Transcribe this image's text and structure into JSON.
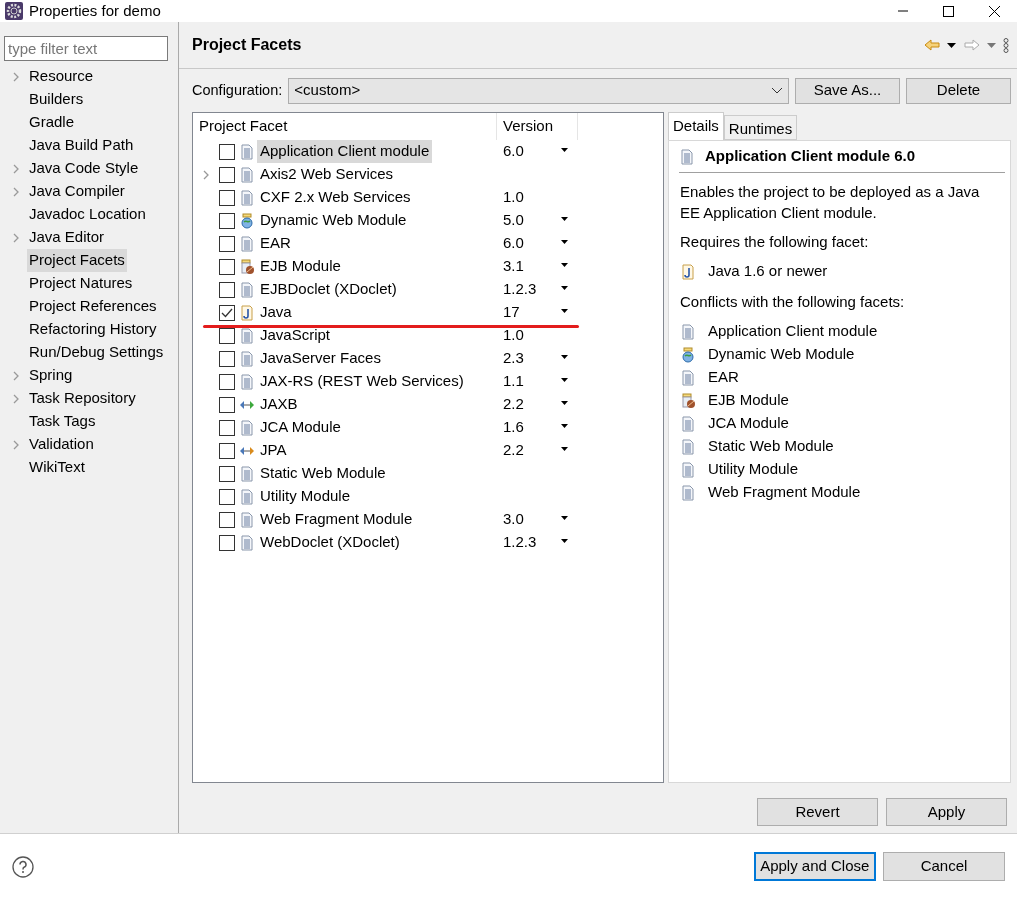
{
  "window": {
    "title": "Properties for demo"
  },
  "filter": {
    "placeholder": "type filter text"
  },
  "sidebar": {
    "items": [
      {
        "label": "Resource",
        "expandable": true,
        "selected": false
      },
      {
        "label": "Builders",
        "expandable": false,
        "selected": false
      },
      {
        "label": "Gradle",
        "expandable": false,
        "selected": false
      },
      {
        "label": "Java Build Path",
        "expandable": false,
        "selected": false
      },
      {
        "label": "Java Code Style",
        "expandable": true,
        "selected": false
      },
      {
        "label": "Java Compiler",
        "expandable": true,
        "selected": false
      },
      {
        "label": "Javadoc Location",
        "expandable": false,
        "selected": false
      },
      {
        "label": "Java Editor",
        "expandable": true,
        "selected": false
      },
      {
        "label": "Project Facets",
        "expandable": false,
        "selected": true
      },
      {
        "label": "Project Natures",
        "expandable": false,
        "selected": false
      },
      {
        "label": "Project References",
        "expandable": false,
        "selected": false
      },
      {
        "label": "Refactoring History",
        "expandable": false,
        "selected": false
      },
      {
        "label": "Run/Debug Settings",
        "expandable": false,
        "selected": false
      },
      {
        "label": "Spring",
        "expandable": true,
        "selected": false
      },
      {
        "label": "Task Repository",
        "expandable": true,
        "selected": false
      },
      {
        "label": "Task Tags",
        "expandable": false,
        "selected": false
      },
      {
        "label": "Validation",
        "expandable": true,
        "selected": false
      },
      {
        "label": "WikiText",
        "expandable": false,
        "selected": false
      }
    ]
  },
  "page": {
    "title": "Project Facets"
  },
  "configuration": {
    "label": "Configuration:",
    "value": "<custom>",
    "buttons": [
      "Save As...",
      "Delete"
    ]
  },
  "facets": {
    "columns": [
      "Project Facet",
      "Version"
    ],
    "rows": [
      {
        "kind": "document",
        "label": "Application Client module",
        "version": "6.0",
        "dropdown": true,
        "checked": false,
        "selected": true,
        "expandable": false,
        "underlined": false
      },
      {
        "kind": "document",
        "label": "Axis2 Web Services",
        "dropdown": false,
        "checked": false,
        "selected": false,
        "expandable": true,
        "underlined": false
      },
      {
        "kind": "document",
        "label": "CXF 2.x Web Services",
        "version": "1.0",
        "dropdown": false,
        "checked": false,
        "selected": false,
        "expandable": false,
        "underlined": false
      },
      {
        "kind": "globe",
        "label": "Dynamic Web Module",
        "version": "5.0",
        "dropdown": true,
        "checked": false,
        "selected": false,
        "expandable": false,
        "underlined": false
      },
      {
        "kind": "document",
        "label": "EAR",
        "version": "6.0",
        "dropdown": true,
        "checked": false,
        "selected": false,
        "expandable": false,
        "underlined": false
      },
      {
        "kind": "bean",
        "label": "EJB Module",
        "version": "3.1",
        "dropdown": true,
        "checked": false,
        "selected": false,
        "expandable": false,
        "underlined": false
      },
      {
        "kind": "document",
        "label": "EJBDoclet (XDoclet)",
        "version": "1.2.3",
        "dropdown": true,
        "checked": false,
        "selected": false,
        "expandable": false,
        "underlined": false
      },
      {
        "kind": "java",
        "label": "Java",
        "version": "17",
        "dropdown": true,
        "checked": true,
        "selected": false,
        "expandable": false,
        "underlined": true
      },
      {
        "kind": "document",
        "label": "JavaScript",
        "version": "1.0",
        "dropdown": false,
        "checked": false,
        "selected": false,
        "expandable": false,
        "underlined": false
      },
      {
        "kind": "document",
        "label": "JavaServer Faces",
        "version": "2.3",
        "dropdown": true,
        "checked": false,
        "selected": false,
        "expandable": false,
        "underlined": false
      },
      {
        "kind": "document",
        "label": "JAX-RS (REST Web Services)",
        "version": "1.1",
        "dropdown": true,
        "checked": false,
        "selected": false,
        "expandable": false,
        "underlined": false
      },
      {
        "kind": "arrows-green",
        "label": "JAXB",
        "version": "2.2",
        "dropdown": true,
        "checked": false,
        "selected": false,
        "expandable": false,
        "underlined": false
      },
      {
        "kind": "document",
        "label": "JCA Module",
        "version": "1.6",
        "dropdown": true,
        "checked": false,
        "selected": false,
        "expandable": false,
        "underlined": false
      },
      {
        "kind": "arrows-orange",
        "label": "JPA",
        "version": "2.2",
        "dropdown": true,
        "checked": false,
        "selected": false,
        "expandable": false,
        "underlined": false
      },
      {
        "kind": "document",
        "label": "Static Web Module",
        "dropdown": false,
        "checked": false,
        "selected": false,
        "expandable": false,
        "underlined": false
      },
      {
        "kind": "document",
        "label": "Utility Module",
        "dropdown": false,
        "checked": false,
        "selected": false,
        "expandable": false,
        "underlined": false
      },
      {
        "kind": "document",
        "label": "Web Fragment Module",
        "version": "3.0",
        "dropdown": true,
        "checked": false,
        "selected": false,
        "expandable": false,
        "underlined": false
      },
      {
        "kind": "document",
        "label": "WebDoclet (XDoclet)",
        "version": "1.2.3",
        "dropdown": true,
        "checked": false,
        "selected": false,
        "expandable": false,
        "underlined": false
      }
    ]
  },
  "details": {
    "tabs": [
      {
        "label": "Details",
        "selected": true
      },
      {
        "label": "Runtimes",
        "selected": false
      }
    ],
    "title": "Application Client module 6.0",
    "description": "Enables the project to be deployed as a Java EE Application Client module.",
    "requires_label": "Requires the following facet:",
    "requires": [
      {
        "kind": "java",
        "label": "Java 1.6 or newer"
      }
    ],
    "conflicts_label": "Conflicts with the following facets:",
    "conflicts": [
      {
        "kind": "document",
        "label": "Application Client module"
      },
      {
        "kind": "globe",
        "label": "Dynamic Web Module"
      },
      {
        "kind": "document",
        "label": "EAR"
      },
      {
        "kind": "bean",
        "label": "EJB Module"
      },
      {
        "kind": "document",
        "label": "JCA Module"
      },
      {
        "kind": "document",
        "label": "Static Web Module"
      },
      {
        "kind": "document",
        "label": "Utility Module"
      },
      {
        "kind": "document",
        "label": "Web Fragment Module"
      }
    ]
  },
  "page_buttons": [
    "Revert",
    "Apply"
  ],
  "footer_buttons": [
    {
      "label": "Apply and Close",
      "default": true
    },
    {
      "label": "Cancel",
      "default": false
    }
  ]
}
